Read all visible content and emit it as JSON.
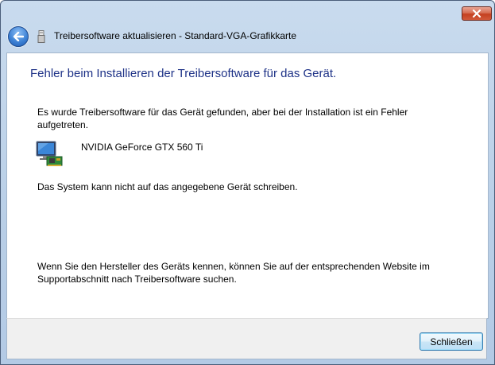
{
  "window": {
    "title": "Treibersoftware aktualisieren - Standard-VGA-Grafikkarte"
  },
  "icons": {
    "close": "close-icon",
    "back": "back-arrow-icon",
    "title": "usb-device-icon",
    "device": "display-adapter-icon"
  },
  "content": {
    "heading": "Fehler beim Installieren der Treibersoftware für das Gerät.",
    "description": "Es wurde Treibersoftware für das Gerät gefunden, aber bei der Installation ist ein Fehler aufgetreten.",
    "device_name": "NVIDIA GeForce GTX 560 Ti",
    "error_message": "Das System kann nicht auf das angegebene Gerät schreiben.",
    "hint": "Wenn Sie den Hersteller des Geräts kennen, können Sie auf der entsprechenden Website im Supportabschnitt nach Treibersoftware suchen."
  },
  "footer": {
    "close_label": "Schließen"
  },
  "colors": {
    "heading": "#1e3287",
    "frame": "#b9cfe7",
    "close_button": "#c4401f"
  }
}
